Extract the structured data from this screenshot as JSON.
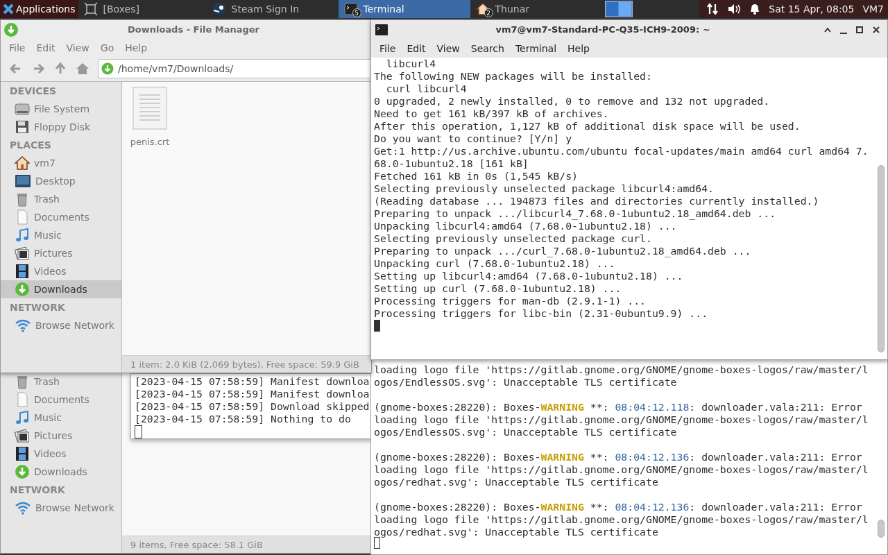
{
  "taskbar": {
    "menu_label": "Applications",
    "tasks": [
      {
        "label": "[Boxes]",
        "kind": "boxes",
        "selected": false
      },
      {
        "label": "Steam Sign In",
        "kind": "steam",
        "selected": false
      },
      {
        "label": "Terminal",
        "kind": "terminal",
        "selected": true,
        "count": "5"
      },
      {
        "label": "Thunar",
        "kind": "home",
        "selected": false,
        "count": "2"
      }
    ],
    "clock": "Sat 15 Apr, 08:05",
    "user": "VM7"
  },
  "file_manager": {
    "title": "Downloads - File Manager",
    "menu": [
      "File",
      "Edit",
      "View",
      "Go",
      "Help"
    ],
    "path": "/home/vm7/Downloads/",
    "sidebar": [
      {
        "heading": "DEVICES",
        "items": [
          {
            "label": "File System",
            "kind": "drive",
            "selected": false
          },
          {
            "label": "Floppy Disk",
            "kind": "floppy",
            "selected": false
          }
        ]
      },
      {
        "heading": "PLACES",
        "items": [
          {
            "label": "vm7",
            "kind": "home",
            "selected": false
          },
          {
            "label": "Desktop",
            "kind": "desktop",
            "selected": false
          },
          {
            "label": "Trash",
            "kind": "trash",
            "selected": false
          },
          {
            "label": "Documents",
            "kind": "document",
            "selected": false
          },
          {
            "label": "Music",
            "kind": "music",
            "selected": false
          },
          {
            "label": "Pictures",
            "kind": "pictures",
            "selected": false
          },
          {
            "label": "Videos",
            "kind": "videos",
            "selected": false
          },
          {
            "label": "Downloads",
            "kind": "downloads",
            "selected": true
          }
        ]
      },
      {
        "heading": "NETWORK",
        "items": [
          {
            "label": "Browse Network",
            "kind": "network",
            "selected": false
          }
        ]
      }
    ],
    "files": [
      {
        "name": "penis.crt"
      }
    ],
    "status": "1 item: 2.0 KiB (2,069 bytes), Free space: 59.9 GiB"
  },
  "back_file_manager": {
    "sidebar": [
      {
        "items": [
          {
            "label": "Trash",
            "kind": "trash",
            "selected": false
          },
          {
            "label": "Documents",
            "kind": "document",
            "selected": false
          },
          {
            "label": "Music",
            "kind": "music",
            "selected": false
          },
          {
            "label": "Pictures",
            "kind": "pictures",
            "selected": false
          },
          {
            "label": "Videos",
            "kind": "videos",
            "selected": false
          },
          {
            "label": "Downloads",
            "kind": "downloads",
            "selected": false
          }
        ]
      },
      {
        "heading": "NETWORK",
        "items": [
          {
            "label": "Browse Network",
            "kind": "network",
            "selected": false
          }
        ]
      }
    ],
    "log_window": {
      "lines": [
        "[2023-04-15 07:58:59] Manifest downloa",
        "[2023-04-15 07:58:59] Manifest downloa",
        "[2023-04-15 07:58:59] Download skipped",
        "[2023-04-15 07:58:59] Nothing to do"
      ]
    },
    "status": "9 items, Free space: 58.1 GiB"
  },
  "terminal": {
    "title": "vm7@vm7-Standard-PC-Q35-ICH9-2009: ~",
    "menu": [
      "File",
      "Edit",
      "View",
      "Search",
      "Terminal",
      "Help"
    ],
    "lines": [
      "  libcurl4",
      "The following NEW packages will be installed:",
      "  curl libcurl4",
      "0 upgraded, 2 newly installed, 0 to remove and 132 not upgraded.",
      "Need to get 161 kB/397 kB of archives.",
      "After this operation, 1,127 kB of additional disk space will be used.",
      "Do you want to continue? [Y/n] y",
      "Get:1 http://us.archive.ubuntu.com/ubuntu focal-updates/main amd64 curl amd64 7.",
      "68.0-1ubuntu2.18 [161 kB]",
      "Fetched 161 kB in 0s (1,545 kB/s)",
      "Selecting previously unselected package libcurl4:amd64.",
      "(Reading database ... 194873 files and directories currently installed.)",
      "Preparing to unpack .../libcurl4_7.68.0-1ubuntu2.18_amd64.deb ...",
      "Unpacking libcurl4:amd64 (7.68.0-1ubuntu2.18) ...",
      "Selecting previously unselected package curl.",
      "Preparing to unpack .../curl_7.68.0-1ubuntu2.18_amd64.deb ...",
      "Unpacking curl (7.68.0-1ubuntu2.18) ...",
      "Setting up libcurl4:amd64 (7.68.0-1ubuntu2.18) ...",
      "Setting up curl (7.68.0-1ubuntu2.18) ...",
      "Processing triggers for man-db (2.9.1-1) ...",
      "Processing triggers for libc-bin (2.31-0ubuntu9.9) ..."
    ]
  },
  "boxes_terminal": {
    "entries": [
      {
        "lines": [
          [
            {
              "text": "loading logo file 'https://gitlab.gnome.org/GNOME/gnome-boxes-logos/raw/master/l",
              "kind": "plain"
            }
          ],
          [
            {
              "text": "ogos/EndlessOS.svg': Unacceptable TLS certificate",
              "kind": "plain"
            }
          ]
        ]
      },
      {
        "lines": [
          [
            {
              "text": "(gnome-boxes:28220): Boxes-",
              "kind": "plain"
            },
            {
              "text": "WARNING",
              "kind": "warning"
            },
            {
              "text": " **: ",
              "kind": "plain"
            },
            {
              "text": "08:04:12.118",
              "kind": "time"
            },
            {
              "text": ": downloader.vala:211: Error",
              "kind": "plain"
            }
          ],
          [
            {
              "text": "loading logo file 'https://gitlab.gnome.org/GNOME/gnome-boxes-logos/raw/master/l",
              "kind": "plain"
            }
          ],
          [
            {
              "text": "ogos/EndlessOS.svg': Unacceptable TLS certificate",
              "kind": "plain"
            }
          ]
        ]
      },
      {
        "lines": [
          [
            {
              "text": "(gnome-boxes:28220): Boxes-",
              "kind": "plain"
            },
            {
              "text": "WARNING",
              "kind": "warning"
            },
            {
              "text": " **: ",
              "kind": "plain"
            },
            {
              "text": "08:04:12.136",
              "kind": "time"
            },
            {
              "text": ": downloader.vala:211: Error",
              "kind": "plain"
            }
          ],
          [
            {
              "text": "loading logo file 'https://gitlab.gnome.org/GNOME/gnome-boxes-logos/raw/master/l",
              "kind": "plain"
            }
          ],
          [
            {
              "text": "ogos/redhat.svg': Unacceptable TLS certificate",
              "kind": "plain"
            }
          ]
        ]
      },
      {
        "lines": [
          [
            {
              "text": "(gnome-boxes:28220): Boxes-",
              "kind": "plain"
            },
            {
              "text": "WARNING",
              "kind": "warning"
            },
            {
              "text": " **: ",
              "kind": "plain"
            },
            {
              "text": "08:04:12.136",
              "kind": "time"
            },
            {
              "text": ": downloader.vala:211: Error",
              "kind": "plain"
            }
          ],
          [
            {
              "text": "loading logo file 'https://gitlab.gnome.org/GNOME/gnome-boxes-logos/raw/master/l",
              "kind": "plain"
            }
          ],
          [
            {
              "text": "ogos/redhat.svg': Unacceptable TLS certificate",
              "kind": "plain"
            }
          ]
        ]
      }
    ]
  }
}
